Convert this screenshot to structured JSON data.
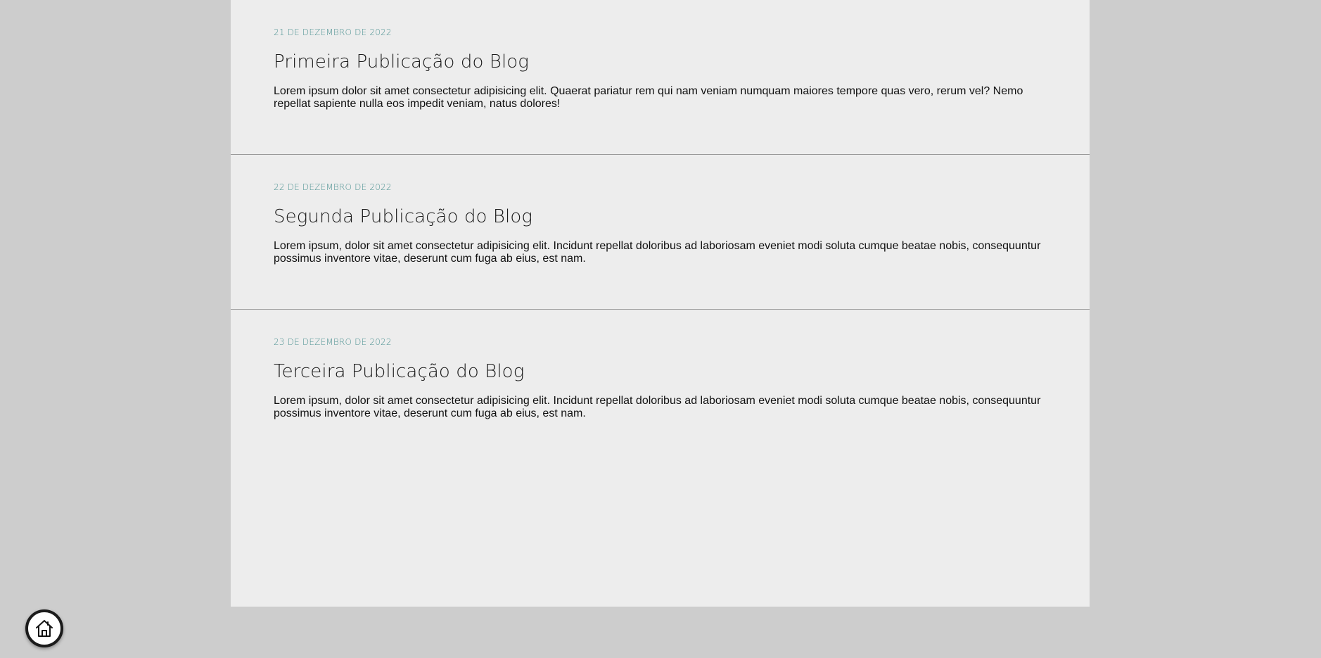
{
  "posts": [
    {
      "date": "21 DE DEZEMBRO DE 2022",
      "title": "Primeira Publicação do Blog",
      "body": "Lorem ipsum dolor sit amet consectetur adipisicing elit. Quaerat pariatur rem qui nam veniam numquam maiores tempore quas vero, rerum vel? Nemo repellat sapiente nulla eos impedit veniam, natus dolores!"
    },
    {
      "date": "22 DE DEZEMBRO DE 2022",
      "title": "Segunda Publicação do Blog",
      "body": "Lorem ipsum, dolor sit amet consectetur adipisicing elit. Incidunt repellat doloribus ad laboriosam eveniet modi soluta cumque beatae nobis, consequuntur possimus inventore vitae, deserunt cum fuga ab eius, est nam."
    },
    {
      "date": "23 DE DEZEMBRO DE 2022",
      "title": "Terceira Publicação do Blog",
      "body": "Lorem ipsum, dolor sit amet consectetur adipisicing elit. Incidunt repellat doloribus ad laboriosam eveniet modi soluta cumque beatae nobis, consequuntur possimus inventore vitae, deserunt cum fuga ab eius, est nam."
    }
  ],
  "home_button": {
    "icon": "home-icon"
  },
  "colors": {
    "page_background": "#cdcdcd",
    "card_background": "#ededed",
    "date_accent": "#4f9393",
    "divider": "#9a9a9a"
  }
}
